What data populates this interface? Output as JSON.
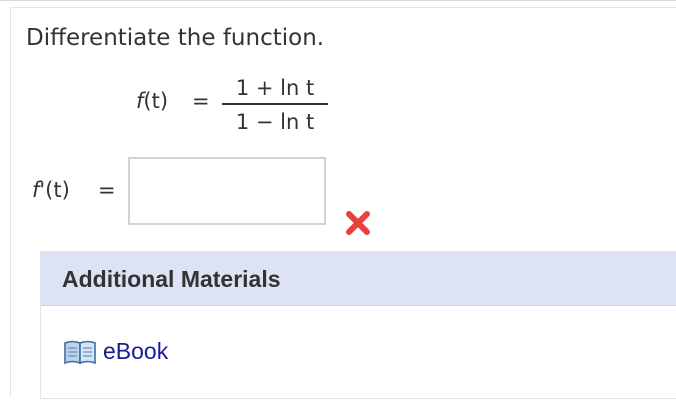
{
  "question": {
    "prompt": "Differentiate the function.",
    "given": {
      "lhs_name": "f",
      "lhs_arg": "(t)",
      "equals": "=",
      "numerator": "1 + ln t",
      "denominator": "1 − ln t"
    },
    "answer": {
      "lhs_name": "f",
      "lhs_suffix": "'(t)",
      "equals": "=",
      "value": "",
      "status_icon": "incorrect-x-icon",
      "status_color": "#e8403c"
    }
  },
  "additional_materials": {
    "title": "Additional Materials",
    "header_color": "#dde3f4",
    "items": [
      {
        "label": "eBook",
        "icon": "book-icon",
        "color": "#1a1a99"
      }
    ]
  }
}
